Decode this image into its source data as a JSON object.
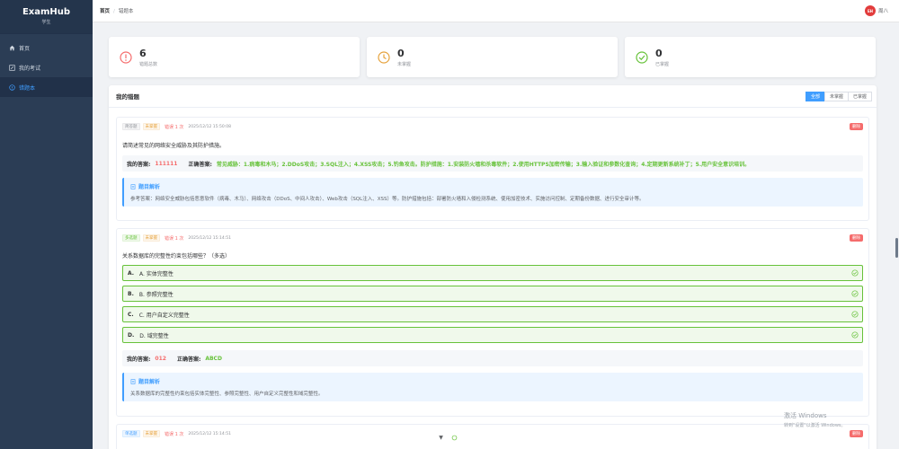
{
  "app": {
    "name": "ExamHub",
    "role": "学生"
  },
  "sidebar": {
    "items": [
      {
        "label": "首页",
        "icon": "home-icon"
      },
      {
        "label": "我的考试",
        "icon": "edit-icon"
      },
      {
        "label": "错题本",
        "icon": "info-icon",
        "active": true
      }
    ]
  },
  "header": {
    "breadcrumb": [
      "首页",
      "错题本"
    ],
    "user": {
      "avatar_text": "ExamHub",
      "name": "周八"
    }
  },
  "stats": [
    {
      "value": "6",
      "label": "错题总数",
      "icon": "alert-icon",
      "color": "#f56c6c"
    },
    {
      "value": "0",
      "label": "未掌握",
      "icon": "clock-icon",
      "color": "#e6a23c"
    },
    {
      "value": "0",
      "label": "已掌握",
      "icon": "check-circle-icon",
      "color": "#67c23a"
    }
  ],
  "panel": {
    "title": "我的错题",
    "filters": [
      "全部",
      "未掌握",
      "已掌握"
    ],
    "active_filter": "全部"
  },
  "cards": [
    {
      "type_tag": "简答题",
      "status_tag": "未掌握",
      "error_count": "错误 1 次",
      "time": "2025/12/12 15:50:08",
      "delete_label": "删除",
      "question": "请简述常见的网络安全威胁及其防护措施。",
      "my_answer_label": "我的答案:",
      "my_answer": "111111",
      "correct_label": "正确答案:",
      "correct_answer": "常见威胁：1.病毒和木马；2.DDoS攻击；3.SQL注入；4.XSS攻击；5.钓鱼攻击。防护措施：1.安装防火墙和杀毒软件；2.使用HTTPS加密传输；3.输入验证和参数化查询；4.定期更新系统补丁；5.用户安全意识培训。",
      "analysis_title": "题目解析",
      "analysis": "参考答案：网络安全威胁包括恶意软件（病毒、木马）、网络攻击（DDoS、中间人攻击）、Web攻击（SQL注入、XSS）等。防护措施包括：部署防火墙和入侵检测系统、使用加密技术、实施访问控制、定期备份数据、进行安全审计等。"
    },
    {
      "type_tag": "多选题",
      "status_tag": "未掌握",
      "error_count": "错误 1 次",
      "time": "2025/12/12 15:14:51",
      "delete_label": "删除",
      "question": "关系数据库的完整性约束包括哪些？（多选）",
      "options": [
        {
          "letter": "A.",
          "text": "A. 实体完整性"
        },
        {
          "letter": "B.",
          "text": "B. 参照完整性"
        },
        {
          "letter": "C.",
          "text": "C. 用户自定义完整性"
        },
        {
          "letter": "D.",
          "text": "D. 域完整性"
        }
      ],
      "my_answer_label": "我的答案:",
      "my_answer": "012",
      "correct_label": "正确答案:",
      "correct_answer": "ABCD",
      "analysis_title": "题目解析",
      "analysis": "关系数据库的完整性约束包括实体完整性、参照完整性、用户自定义完整性和域完整性。"
    },
    {
      "type_tag": "单选题",
      "status_tag": "未掌握",
      "error_count": "错误 1 次",
      "time": "2025/12/12 15:14:51",
      "delete_label": "删除"
    }
  ],
  "watermark": {
    "line1": "激活 Windows",
    "line2": "转到\"设置\"以激活 Windows。"
  },
  "colors": {
    "sidebar_bg": "#2b3d55",
    "primary": "#409eff",
    "danger": "#f56c6c",
    "success": "#67c23a",
    "warning": "#e6a23c"
  }
}
